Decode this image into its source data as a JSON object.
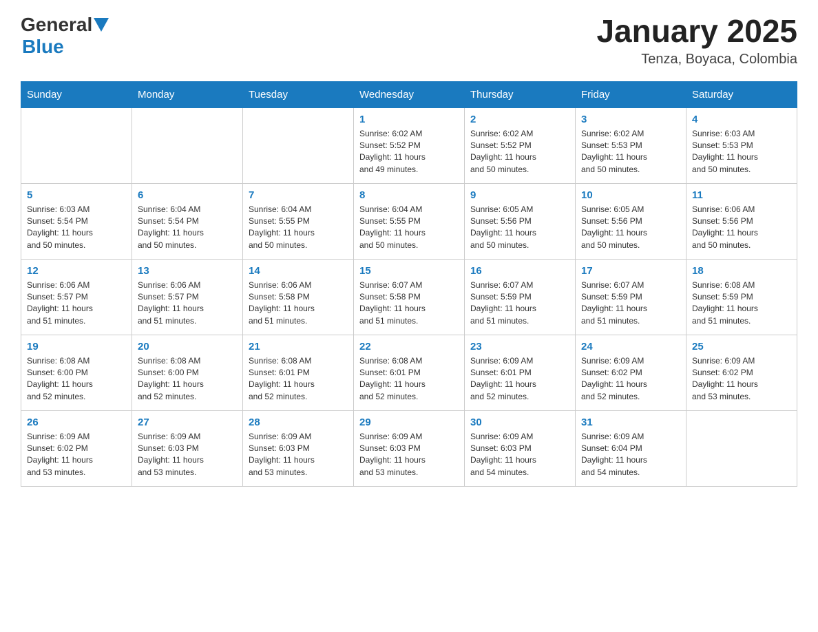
{
  "header": {
    "logo_general": "General",
    "logo_blue": "Blue",
    "month_year": "January 2025",
    "location": "Tenza, Boyaca, Colombia"
  },
  "days_of_week": [
    "Sunday",
    "Monday",
    "Tuesday",
    "Wednesday",
    "Thursday",
    "Friday",
    "Saturday"
  ],
  "weeks": [
    [
      {
        "day": "",
        "info": ""
      },
      {
        "day": "",
        "info": ""
      },
      {
        "day": "",
        "info": ""
      },
      {
        "day": "1",
        "info": "Sunrise: 6:02 AM\nSunset: 5:52 PM\nDaylight: 11 hours\nand 49 minutes."
      },
      {
        "day": "2",
        "info": "Sunrise: 6:02 AM\nSunset: 5:52 PM\nDaylight: 11 hours\nand 50 minutes."
      },
      {
        "day": "3",
        "info": "Sunrise: 6:02 AM\nSunset: 5:53 PM\nDaylight: 11 hours\nand 50 minutes."
      },
      {
        "day": "4",
        "info": "Sunrise: 6:03 AM\nSunset: 5:53 PM\nDaylight: 11 hours\nand 50 minutes."
      }
    ],
    [
      {
        "day": "5",
        "info": "Sunrise: 6:03 AM\nSunset: 5:54 PM\nDaylight: 11 hours\nand 50 minutes."
      },
      {
        "day": "6",
        "info": "Sunrise: 6:04 AM\nSunset: 5:54 PM\nDaylight: 11 hours\nand 50 minutes."
      },
      {
        "day": "7",
        "info": "Sunrise: 6:04 AM\nSunset: 5:55 PM\nDaylight: 11 hours\nand 50 minutes."
      },
      {
        "day": "8",
        "info": "Sunrise: 6:04 AM\nSunset: 5:55 PM\nDaylight: 11 hours\nand 50 minutes."
      },
      {
        "day": "9",
        "info": "Sunrise: 6:05 AM\nSunset: 5:56 PM\nDaylight: 11 hours\nand 50 minutes."
      },
      {
        "day": "10",
        "info": "Sunrise: 6:05 AM\nSunset: 5:56 PM\nDaylight: 11 hours\nand 50 minutes."
      },
      {
        "day": "11",
        "info": "Sunrise: 6:06 AM\nSunset: 5:56 PM\nDaylight: 11 hours\nand 50 minutes."
      }
    ],
    [
      {
        "day": "12",
        "info": "Sunrise: 6:06 AM\nSunset: 5:57 PM\nDaylight: 11 hours\nand 51 minutes."
      },
      {
        "day": "13",
        "info": "Sunrise: 6:06 AM\nSunset: 5:57 PM\nDaylight: 11 hours\nand 51 minutes."
      },
      {
        "day": "14",
        "info": "Sunrise: 6:06 AM\nSunset: 5:58 PM\nDaylight: 11 hours\nand 51 minutes."
      },
      {
        "day": "15",
        "info": "Sunrise: 6:07 AM\nSunset: 5:58 PM\nDaylight: 11 hours\nand 51 minutes."
      },
      {
        "day": "16",
        "info": "Sunrise: 6:07 AM\nSunset: 5:59 PM\nDaylight: 11 hours\nand 51 minutes."
      },
      {
        "day": "17",
        "info": "Sunrise: 6:07 AM\nSunset: 5:59 PM\nDaylight: 11 hours\nand 51 minutes."
      },
      {
        "day": "18",
        "info": "Sunrise: 6:08 AM\nSunset: 5:59 PM\nDaylight: 11 hours\nand 51 minutes."
      }
    ],
    [
      {
        "day": "19",
        "info": "Sunrise: 6:08 AM\nSunset: 6:00 PM\nDaylight: 11 hours\nand 52 minutes."
      },
      {
        "day": "20",
        "info": "Sunrise: 6:08 AM\nSunset: 6:00 PM\nDaylight: 11 hours\nand 52 minutes."
      },
      {
        "day": "21",
        "info": "Sunrise: 6:08 AM\nSunset: 6:01 PM\nDaylight: 11 hours\nand 52 minutes."
      },
      {
        "day": "22",
        "info": "Sunrise: 6:08 AM\nSunset: 6:01 PM\nDaylight: 11 hours\nand 52 minutes."
      },
      {
        "day": "23",
        "info": "Sunrise: 6:09 AM\nSunset: 6:01 PM\nDaylight: 11 hours\nand 52 minutes."
      },
      {
        "day": "24",
        "info": "Sunrise: 6:09 AM\nSunset: 6:02 PM\nDaylight: 11 hours\nand 52 minutes."
      },
      {
        "day": "25",
        "info": "Sunrise: 6:09 AM\nSunset: 6:02 PM\nDaylight: 11 hours\nand 53 minutes."
      }
    ],
    [
      {
        "day": "26",
        "info": "Sunrise: 6:09 AM\nSunset: 6:02 PM\nDaylight: 11 hours\nand 53 minutes."
      },
      {
        "day": "27",
        "info": "Sunrise: 6:09 AM\nSunset: 6:03 PM\nDaylight: 11 hours\nand 53 minutes."
      },
      {
        "day": "28",
        "info": "Sunrise: 6:09 AM\nSunset: 6:03 PM\nDaylight: 11 hours\nand 53 minutes."
      },
      {
        "day": "29",
        "info": "Sunrise: 6:09 AM\nSunset: 6:03 PM\nDaylight: 11 hours\nand 53 minutes."
      },
      {
        "day": "30",
        "info": "Sunrise: 6:09 AM\nSunset: 6:03 PM\nDaylight: 11 hours\nand 54 minutes."
      },
      {
        "day": "31",
        "info": "Sunrise: 6:09 AM\nSunset: 6:04 PM\nDaylight: 11 hours\nand 54 minutes."
      },
      {
        "day": "",
        "info": ""
      }
    ]
  ]
}
